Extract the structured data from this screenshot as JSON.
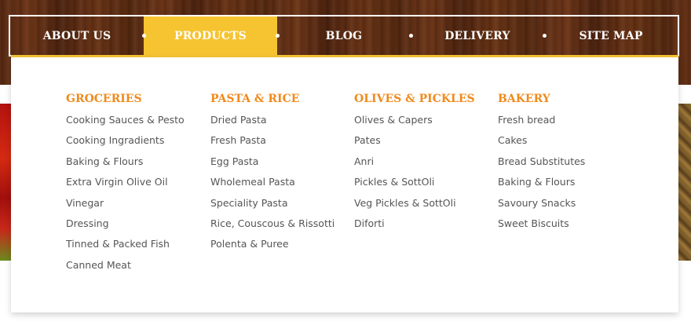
{
  "nav": {
    "items": [
      {
        "label": "ABOUT US"
      },
      {
        "label": "PRODUCTS"
      },
      {
        "label": "BLOG"
      },
      {
        "label": "DELIVERY"
      },
      {
        "label": "SITE MAP"
      }
    ],
    "active_index": 1
  },
  "menu": {
    "columns": [
      {
        "title": "GROCERIES",
        "links": [
          "Cooking Sauces & Pesto",
          "Cooking Ingradients",
          "Baking & Flours",
          "Extra Virgin Olive Oil",
          "Vinegar",
          "Dressing",
          "Tinned & Packed Fish",
          "Canned Meat"
        ]
      },
      {
        "title": "PASTA & RICE",
        "links": [
          "Dried Pasta",
          "Fresh Pasta",
          "Egg Pasta",
          "Wholemeal Pasta",
          "Speciality Pasta",
          "Rice, Couscous & Rissotti",
          "Polenta & Puree"
        ]
      },
      {
        "title": "OLIVES & PICKLES",
        "links": [
          "Olives & Capers",
          "Pates",
          "Anri",
          "Pickles & SottOli",
          "Veg Pickles & SottOli",
          "Diforti"
        ]
      },
      {
        "title": "BAKERY",
        "links": [
          "Fresh bread",
          "Cakes",
          "Bread Substitutes",
          "Baking & Flours",
          "Savoury Snacks",
          "Sweet Biscuits"
        ]
      }
    ]
  },
  "colors": {
    "accent_yellow": "#f6c431",
    "heading_orange": "#f08a1c",
    "link_gray": "#555555",
    "wood_brown": "#5b2d14"
  }
}
